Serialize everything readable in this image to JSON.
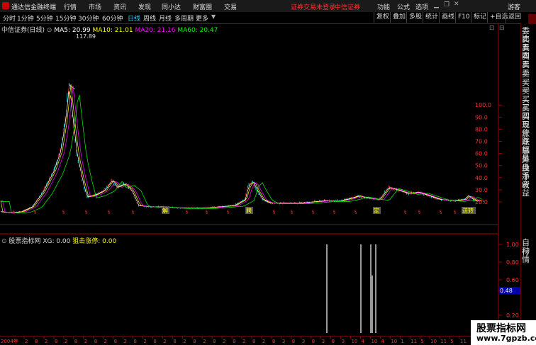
{
  "menubar": {
    "app_name": "通达信金融终端",
    "menus": [
      "行情",
      "市场",
      "资讯",
      "发现",
      "同小达",
      "财富圈",
      "交易"
    ],
    "notice": "证券交易未登录",
    "broker": "中信证券",
    "right_menus": [
      "功能",
      "公式",
      "选项"
    ],
    "user": "游客"
  },
  "toolbar": {
    "periods": [
      "分时",
      "1分钟",
      "5分钟",
      "15分钟",
      "30分钟",
      "60分钟",
      "日线",
      "周线",
      "月线",
      "多周期",
      "更多"
    ],
    "active_period": "日线",
    "buttons": [
      "复权",
      "叠加",
      "多股",
      "统计",
      "画线",
      "F10",
      "标记",
      "+自选",
      "返回"
    ]
  },
  "main_chart": {
    "stock": "中信证券(日线)",
    "ma5": "MA5: 20.99",
    "ma10": "MA10: 21.01",
    "ma20": "MA20: 21.16",
    "ma60": "MA60: 20.47",
    "peak_label": "117.89",
    "y_ticks": [
      "100.0",
      "90.0",
      "80.0",
      "70.0",
      "60.0",
      "50.0",
      "40.0",
      "30.0",
      "20.0"
    ],
    "event_markers": [
      "解",
      "聘",
      "定",
      "送转"
    ]
  },
  "indicator": {
    "name": "股票指标网",
    "xg": "XG: 0.00",
    "zj": "狙击涨停: 0.00",
    "y_ticks": [
      "1.00",
      "0.80",
      "0.60",
      "0.48",
      "0.20"
    ],
    "current_value": "0.48"
  },
  "xaxis": {
    "start": "2004年",
    "ticks": [
      "2",
      "8",
      "2",
      "8",
      "2",
      "8",
      "2",
      "8",
      "2",
      "8",
      "2",
      "8",
      "2",
      "8",
      "2",
      "8",
      "2",
      "8",
      "2",
      "8",
      "2",
      "8",
      "2",
      "8",
      "2",
      "8",
      "3",
      "8",
      "3",
      "8",
      "3",
      "8",
      "3",
      "10",
      "4",
      "10",
      "4",
      "10",
      "1",
      "11",
      "5",
      "10",
      "11",
      "5",
      "11"
    ]
  },
  "side_panel": {
    "top_labels": [
      "委比",
      "卖五",
      "卖四",
      "卖三",
      "卖二",
      "卖一",
      "买一",
      "买二",
      "买三",
      "买四",
      "买五",
      "现价",
      "涨跌",
      "涨幅",
      "总量",
      "外盘",
      "换手",
      "净资",
      "收益"
    ],
    "bottom_labels": [
      "自动",
      "行情"
    ]
  },
  "colors": {
    "up": "#ff3030",
    "down": "#00ffff",
    "ma5": "#ffffff",
    "ma10": "#ffff00",
    "ma20": "#ff00ff",
    "ma60": "#00ff00",
    "axis_border": "#a00000",
    "accent": "#3ad0ff"
  },
  "watermark": {
    "title": "股票指标网",
    "url": "www.7gpzb.com"
  }
}
